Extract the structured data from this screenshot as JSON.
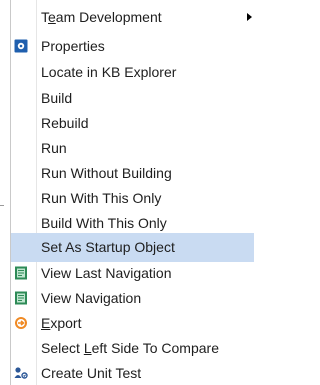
{
  "menu": {
    "items": [
      {
        "name": "team-development",
        "pre": "T",
        "accel": "e",
        "post": "am Development",
        "icon": "",
        "submenu": true
      },
      {
        "name": "properties",
        "pre": "",
        "accel": "",
        "post": "Properties",
        "icon": "properties-icon"
      },
      {
        "name": "locate-in-kb-explorer",
        "pre": "",
        "accel": "",
        "post": "Locate in KB Explorer",
        "icon": ""
      },
      {
        "name": "build",
        "pre": "",
        "accel": "",
        "post": "Build",
        "icon": ""
      },
      {
        "name": "rebuild",
        "pre": "",
        "accel": "",
        "post": "Rebuild",
        "icon": ""
      },
      {
        "name": "run",
        "pre": "",
        "accel": "",
        "post": "Run",
        "icon": ""
      },
      {
        "name": "run-without-building",
        "pre": "",
        "accel": "",
        "post": "Run Without Building",
        "icon": ""
      },
      {
        "name": "run-with-this-only",
        "pre": "",
        "accel": "",
        "post": "Run With This Only",
        "icon": ""
      },
      {
        "name": "build-with-this-only",
        "pre": "",
        "accel": "",
        "post": "Build With This Only",
        "icon": ""
      },
      {
        "name": "set-as-startup-object",
        "pre": "",
        "accel": "",
        "post": "Set As Startup Object",
        "icon": "",
        "selected": true
      },
      {
        "name": "view-last-navigation",
        "pre": "",
        "accel": "",
        "post": "View Last Navigation",
        "icon": "navigation-report-icon"
      },
      {
        "name": "view-navigation",
        "pre": "",
        "accel": "",
        "post": "View Navigation",
        "icon": "navigation-report-icon"
      },
      {
        "name": "export",
        "pre": "",
        "accel": "E",
        "post": "xport",
        "icon": "export-icon"
      },
      {
        "name": "select-left-side-to-compare",
        "pre": "Select ",
        "accel": "L",
        "post": "eft Side To Compare",
        "icon": ""
      },
      {
        "name": "create-unit-test",
        "pre": "",
        "accel": "",
        "post": "Create Unit Test",
        "icon": "unit-test-icon"
      }
    ]
  },
  "colors": {
    "selection": "#c9dbf2",
    "text": "#1e1e1e",
    "properties_icon": "#1f5fae",
    "navigation_icon": "#2e8b57",
    "export_icon": "#f08a24",
    "unit_test_icon": "#2b5797"
  }
}
